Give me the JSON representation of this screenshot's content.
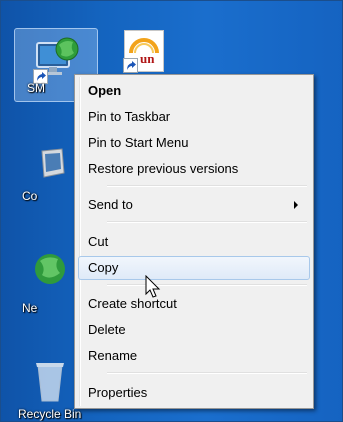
{
  "desktop": {
    "icons": [
      {
        "label": "SM",
        "icon": "network-globe-computer-icon"
      },
      {
        "label": "",
        "icon": "un-shortcut-icon"
      },
      {
        "label": "Co",
        "icon": "computer-icon"
      },
      {
        "label": "Ne",
        "icon": "network-icon"
      },
      {
        "label": "Recycle Bin",
        "icon": "recycle-bin-icon"
      }
    ],
    "un_icon_text": "un"
  },
  "context_menu": {
    "items": [
      {
        "label": "Open"
      },
      {
        "label": "Pin to Taskbar"
      },
      {
        "label": "Pin to Start Menu"
      },
      {
        "label": "Restore previous versions"
      },
      {
        "label": "Send to"
      },
      {
        "label": "Cut"
      },
      {
        "label": "Copy"
      },
      {
        "label": "Create shortcut"
      },
      {
        "label": "Delete"
      },
      {
        "label": "Rename"
      },
      {
        "label": "Properties"
      }
    ],
    "hovered_item": "Copy"
  }
}
